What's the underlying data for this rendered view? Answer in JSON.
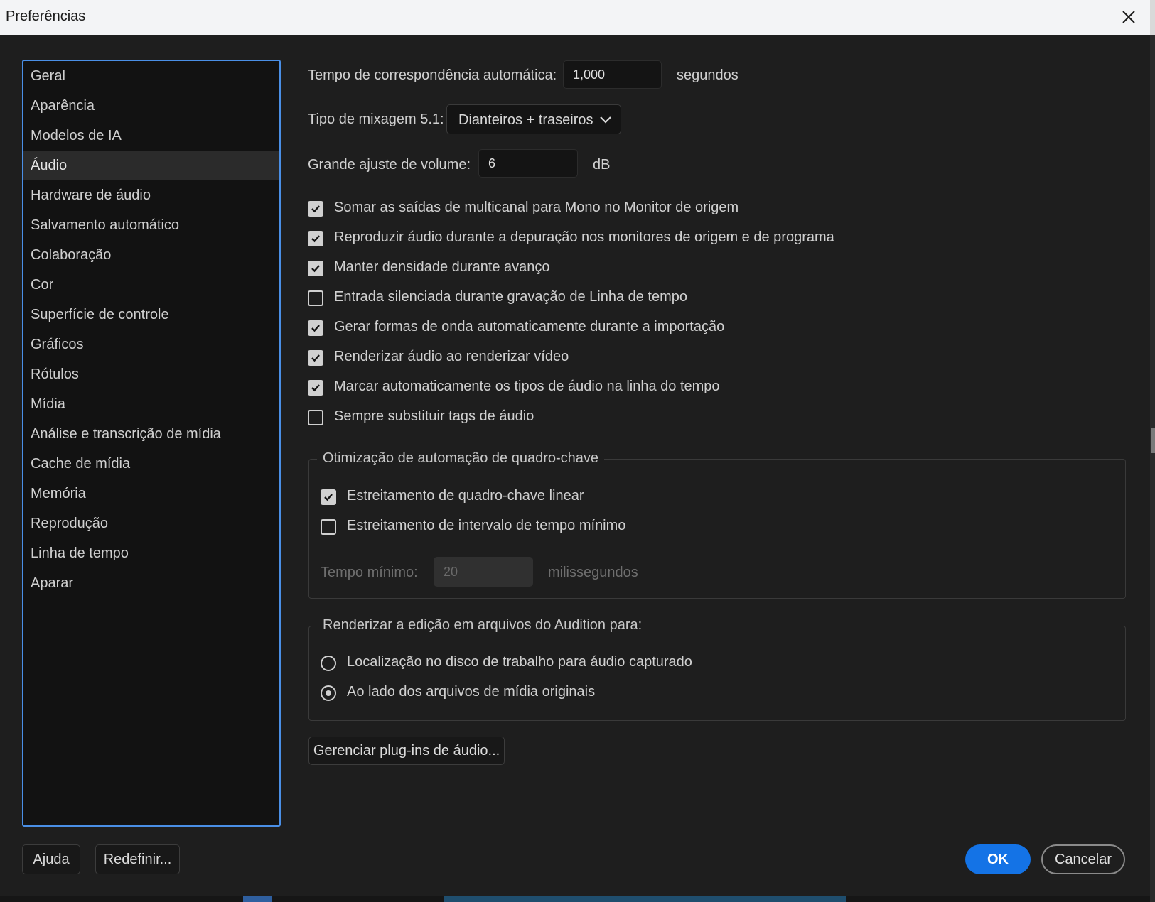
{
  "window": {
    "title": "Preferências"
  },
  "sidebar": {
    "selected_index": 3,
    "items": [
      "Geral",
      "Aparência",
      "Modelos de IA",
      "Áudio",
      "Hardware de áudio",
      "Salvamento automático",
      "Colaboração",
      "Cor",
      "Superfície de controle",
      "Gráficos",
      "Rótulos",
      "Mídia",
      "Análise e transcrição de mídia",
      "Cache de mídia",
      "Memória",
      "Reprodução",
      "Linha de tempo",
      "Aparar"
    ]
  },
  "audio": {
    "auto_match": {
      "label": "Tempo de correspondência automática:",
      "value": "1,000",
      "unit": "segundos"
    },
    "mix_type": {
      "label": "Tipo de mixagem 5.1:",
      "value": "Dianteiros + traseiros"
    },
    "volume": {
      "label": "Grande ajuste de volume:",
      "value": "6",
      "unit": "dB"
    },
    "checkboxes": [
      {
        "label": "Somar as saídas de multicanal para Mono no Monitor de origem",
        "checked": true
      },
      {
        "label": "Reproduzir áudio durante a depuração nos monitores de origem e de programa",
        "checked": true
      },
      {
        "label": "Manter densidade durante avanço",
        "checked": true
      },
      {
        "label": "Entrada silenciada durante gravação de Linha de tempo",
        "checked": false
      },
      {
        "label": "Gerar formas de onda automaticamente durante a importação",
        "checked": true
      },
      {
        "label": "Renderizar áudio ao renderizar vídeo",
        "checked": true
      },
      {
        "label": "Marcar automaticamente os tipos de áudio na linha do tempo",
        "checked": true
      },
      {
        "label": "Sempre substituir tags de áudio",
        "checked": false
      }
    ],
    "keyframe_group": {
      "title": "Otimização de automação de quadro-chave",
      "options": [
        {
          "label": "Estreitamento de quadro-chave linear",
          "checked": true
        },
        {
          "label": "Estreitamento de intervalo de tempo mínimo",
          "checked": false
        }
      ],
      "min_time": {
        "label": "Tempo mínimo:",
        "value": "20",
        "unit": "milissegundos",
        "enabled": false
      }
    },
    "render_group": {
      "title": "Renderizar a edição em arquivos do Audition para:",
      "options": [
        {
          "label": "Localização no disco de trabalho para áudio capturado",
          "selected": false
        },
        {
          "label": "Ao lado dos arquivos de mídia originais",
          "selected": true
        }
      ]
    },
    "manage_plugins_label": "Gerenciar plug-ins de áudio..."
  },
  "footer": {
    "help_label": "Ajuda",
    "reset_label": "Redefinir...",
    "ok_label": "OK",
    "cancel_label": "Cancelar"
  },
  "colors": {
    "accent": "#1473e6",
    "focus_border": "#4a8fe6",
    "background": "#1e1e1e"
  }
}
